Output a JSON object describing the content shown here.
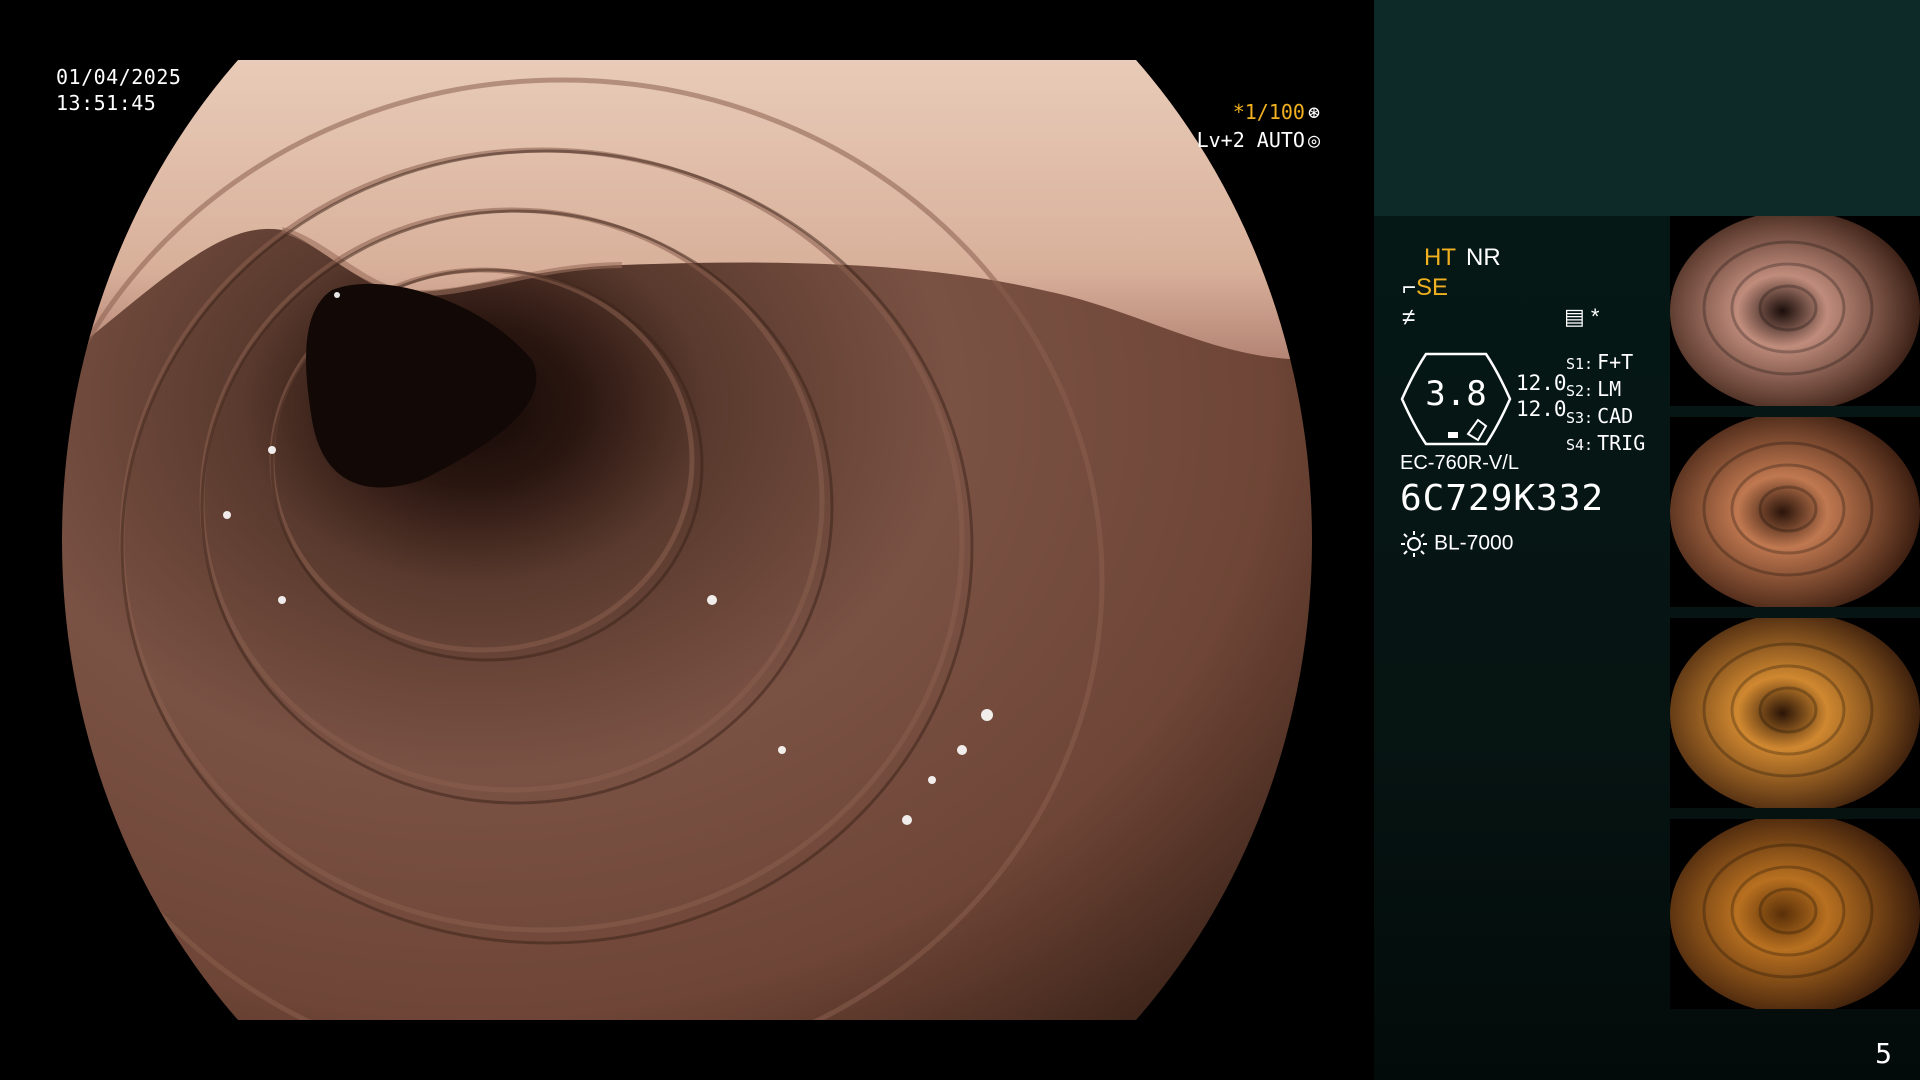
{
  "datetime": {
    "date": "01/04/2025",
    "time": "13:51:45"
  },
  "image_settings": {
    "shutter": "*1/100",
    "shutter_icon": "aperture-icon",
    "level": "Lv+2 AUTO",
    "level_icon": "iris-icon"
  },
  "panel": {
    "ht": "HT",
    "nr": "NR",
    "se": "SE",
    "se_icon": "structure-enhance-icon",
    "f_icon": "freeze-icon",
    "memo_icon": "memo-icon",
    "memo_symbol": "*",
    "zoom_value": "3.8",
    "zoom_side_1": "12.0",
    "zoom_side_2": "12.0",
    "switches": [
      {
        "key": "S1:",
        "value": "F+T"
      },
      {
        "key": "S2:",
        "value": "LM"
      },
      {
        "key": "S3:",
        "value": "CAD"
      },
      {
        "key": "S4:",
        "value": "TRIG"
      }
    ],
    "scope_model": "EC-760R-V/L",
    "scope_serial": "6C729K332",
    "light_icon": "light-source-icon",
    "light_source": "BL-7000"
  },
  "thumbnails": [
    {
      "tone": "#c08c7c",
      "lumen": "#1a0d0a"
    },
    {
      "tone": "#c07850",
      "lumen": "#2a140a"
    },
    {
      "tone": "#d08830",
      "lumen": "#2a1406"
    },
    {
      "tone": "#b87020",
      "lumen": "#5a3008"
    }
  ],
  "page_number": "5",
  "colors": {
    "accent": "#f0b020",
    "panel_top": "#0e2a28",
    "panel": "#051816"
  }
}
